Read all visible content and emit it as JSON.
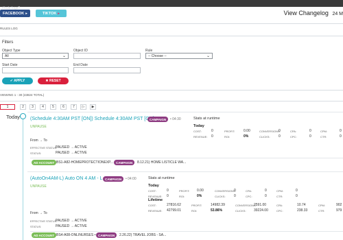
{
  "browser": {
    "url_fragment": "#/rule-logs?"
  },
  "platform_tabs": [
    {
      "label": "FACEBOOK",
      "caret": "▸"
    },
    {
      "label": "TIKTOK",
      "caret": "▸"
    }
  ],
  "header": {
    "title": "View Changelog",
    "extra": "24 M"
  },
  "breadcrumb": "RULES LOG",
  "filters": {
    "title": "Filters",
    "object_type": {
      "label": "Object Type",
      "value": "All"
    },
    "object_id": {
      "label": "Object ID",
      "value": ""
    },
    "rule": {
      "label": "Rule",
      "value": "-- Choose --"
    },
    "start_date": {
      "label": "Start Date",
      "value": ""
    },
    "end_date": {
      "label": "End Date",
      "value": ""
    },
    "apply_label": "✔ APPLY",
    "reset_label": "✖ RESET"
  },
  "results_summary": "VIEWING 1 - 30 (43824 TOTAL)",
  "pagination": [
    "1",
    "2",
    "3",
    "4",
    "5",
    "6",
    "7",
    "▷",
    "▶"
  ],
  "timeline": {
    "day_label": "Today"
  },
  "entries": [
    {
      "title": "(Schedule 4:30AM PST [ON]) Schedule 4:30AM PST [ON] -",
      "badge": "CAMPAIGN",
      "time": "• 04:30",
      "action": "UNPAUSE",
      "from_to": "From → To",
      "effective_status_label": "EFFECTIVE STATUS:",
      "effective_status": "PAUSED → ACTIVE",
      "status_label": "STATUS:",
      "status": "PAUSED → ACTIVE",
      "ad_account_badge": "AD ACCOUNT",
      "ad_account_name": "BS1-A82-HOMEPROTECTIONEXP... •",
      "campaign_badge": "CAMPAIGN",
      "campaign_name": "8.12.21) HOME LISTICLE WA...",
      "stats": {
        "title": "Stats at runtime",
        "today_label": "Today",
        "today": {
          "cost": [
            "COST:",
            "0"
          ],
          "profit": [
            "PROFIT:",
            "0.00"
          ],
          "conversions": [
            "CONVERSIONS:",
            "0"
          ],
          "cpa": [
            "CPA:",
            "0"
          ],
          "cpm": [
            "CPM:",
            "0"
          ],
          "revenue": [
            "REVENUE:",
            "0"
          ],
          "roi": [
            "ROI:",
            "0%"
          ],
          "clicks": [
            "CLICKS:",
            "0"
          ],
          "cpc": [
            "CPC:",
            "0"
          ],
          "ctr": [
            "CTR:",
            "0"
          ]
        }
      }
    },
    {
      "title": "(AutoOn4AM-L) Auto ON 4 AM - L -",
      "badge": "CAMPAIGN",
      "time": "• 04:00",
      "action": "UNPAUSE",
      "from_to": "From → To",
      "effective_status_label": "EFFECTIVE STATUS:",
      "effective_status": "PAUSED → ACTIVE",
      "status_label": "STATUS:",
      "status": "PAUSED → ACTIVE",
      "ad_account_badge": "AD ACCOUNT",
      "ad_account_name": "BS4-A08-ONLINURSES •",
      "campaign_badge": "CAMPAIGN",
      "campaign_name": "2.26.22) TRAVEL JOBS - SA...",
      "stats": {
        "title": "Stats at runtime",
        "today_label": "Today",
        "today": {
          "cost": [
            "COST:",
            "0"
          ],
          "profit": [
            "PROFIT:",
            "0.00"
          ],
          "conversions": [
            "CONVERSIONS:",
            "0"
          ],
          "cpa": [
            "CPA:",
            "0"
          ],
          "cpm": [
            "CPM:",
            "0"
          ],
          "revenue": [
            "REVENUE:",
            "0"
          ],
          "roi": [
            "ROI:",
            "0%"
          ],
          "clicks": [
            "CLICKS:",
            "0"
          ],
          "cpc": [
            "CPC:",
            "0"
          ],
          "ctr": [
            "CTR:",
            "0"
          ]
        },
        "lifetime_label": "Lifetime",
        "lifetime": {
          "cost": [
            "COST:",
            "27816.62"
          ],
          "profit": [
            "PROFIT:",
            "14982.39"
          ],
          "conversions": [
            "CONVERSIONS:",
            "2591.00"
          ],
          "cpa": [
            "CPA:",
            "10.74"
          ],
          "cpm": [
            "CPM:",
            "902"
          ],
          "revenue": [
            "REVENUE:",
            "42799.01"
          ],
          "roi": [
            "ROI:",
            "53.86%"
          ],
          "clicks": [
            "CLICKS:",
            "39224.00"
          ],
          "cpc": [
            "CPC:",
            "238.33"
          ],
          "ctr": [
            "CTR:",
            "979"
          ]
        }
      }
    }
  ]
}
